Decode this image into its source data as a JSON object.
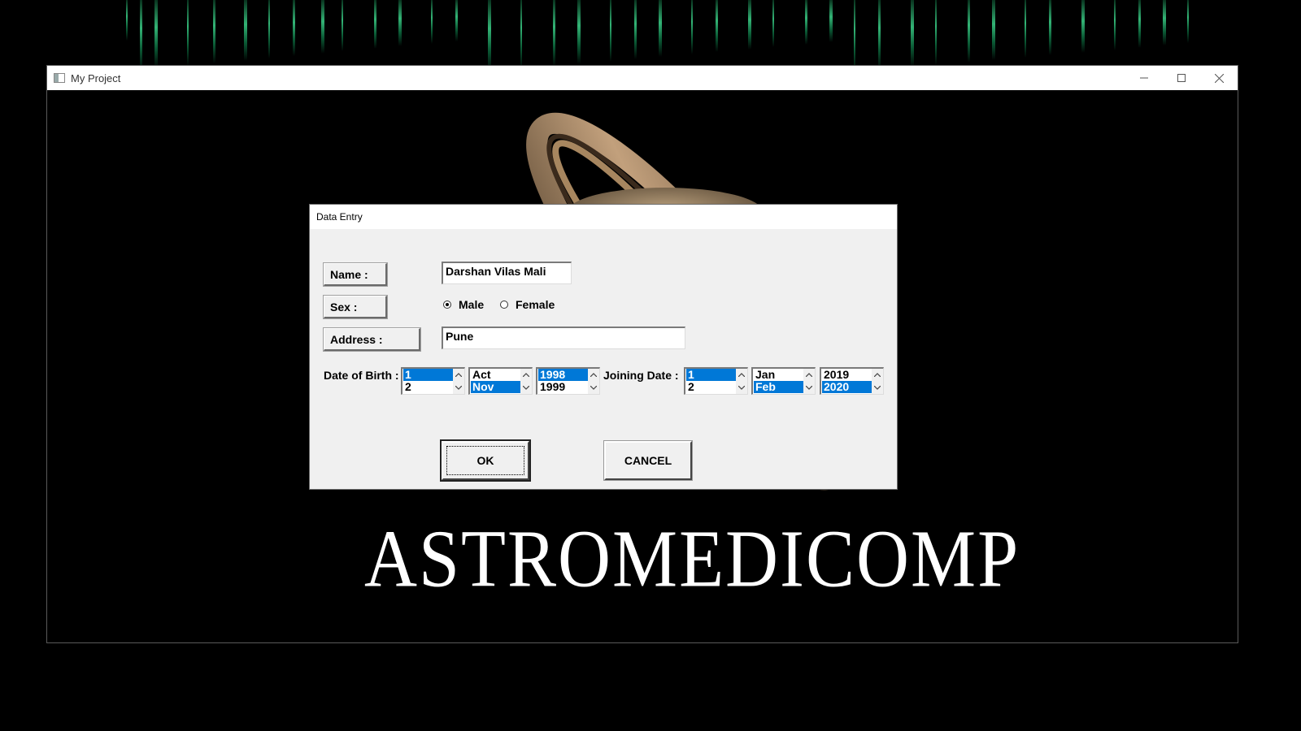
{
  "window": {
    "title": "My Project",
    "brand_text": "ASTROMEDICOMP"
  },
  "dialog": {
    "title": "Data Entry",
    "name_label": "Name :",
    "name_value": "Darshan Vilas Mali",
    "sex_label": "Sex :",
    "sex_options": [
      "Male",
      "Female"
    ],
    "sex_selected": "Male",
    "address_label": "Address :",
    "address_value": "Pune",
    "dob_label": "Date of Birth :",
    "dob": {
      "day": {
        "items": [
          "1",
          "2"
        ],
        "selected": "1"
      },
      "month": {
        "items": [
          "Act",
          "Nov"
        ],
        "selected": "Nov"
      },
      "year": {
        "items": [
          "1998",
          "1999"
        ],
        "selected": "1998"
      }
    },
    "joining_label": "Joining Date :",
    "joining": {
      "day": {
        "items": [
          "1",
          "2"
        ],
        "selected": "1"
      },
      "month": {
        "items": [
          "Jan",
          "Feb"
        ],
        "selected": "Feb"
      },
      "year": {
        "items": [
          "2019",
          "2020"
        ],
        "selected": "2020"
      }
    },
    "ok_label": "OK",
    "cancel_label": "CANCEL"
  },
  "colors": {
    "selection": "#0078d7",
    "dialog_bg": "#f0f0f0",
    "matrix_green": "#3cd38a"
  },
  "icons": [
    "app-icon",
    "minimize-icon",
    "maximize-icon",
    "close-icon",
    "chevron-up-icon",
    "chevron-down-icon"
  ]
}
